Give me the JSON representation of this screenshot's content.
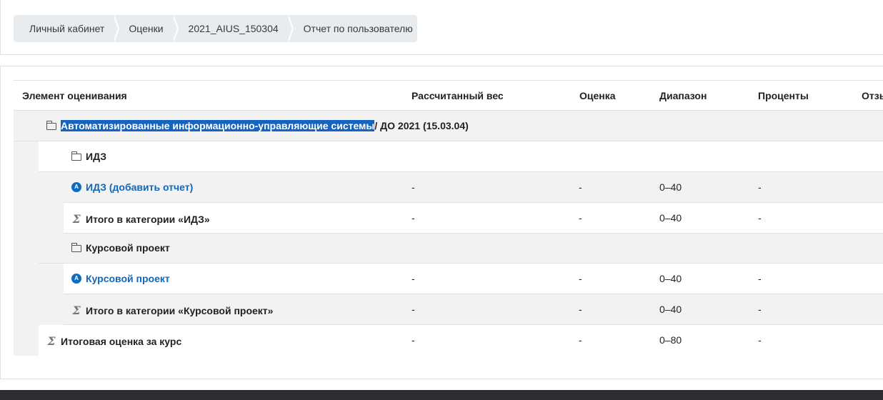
{
  "breadcrumb": {
    "items": [
      "Личный кабинет",
      "Оценки",
      "2021_AIUS_150304",
      "Отчет по пользователю"
    ]
  },
  "table": {
    "headers": {
      "item": "Элемент оценивания",
      "weight": "Рассчитанный вес",
      "grade": "Оценка",
      "range": "Диапазон",
      "percent": "Проценты",
      "feedback": "Отзы"
    },
    "course": {
      "selected": "Автоматизированные информационно-управляющие системы",
      "rest": " / ДО 2021 (15.03.04)"
    },
    "rows": [
      {
        "label": "ИДЗ",
        "icon": "folder-icon"
      },
      {
        "label": "ИДЗ (добавить отчет)",
        "icon": "assignment-icon",
        "weight": "-",
        "grade": "-",
        "range": "0–40",
        "percent": "-"
      },
      {
        "label": "Итого в категории «ИДЗ»",
        "icon": "sigma-icon",
        "weight": "-",
        "grade": "-",
        "range": "0–40",
        "percent": "-"
      },
      {
        "label": "Курсовой проект",
        "icon": "folder-icon"
      },
      {
        "label": "Курсовой проект",
        "icon": "assignment-icon",
        "weight": "-",
        "grade": "-",
        "range": "0–40",
        "percent": "-"
      },
      {
        "label": "Итого в категории «Курсовой проект»",
        "icon": "sigma-icon",
        "weight": "-",
        "grade": "-",
        "range": "0–40",
        "percent": "-"
      },
      {
        "label": "Итоговая оценка за курс",
        "icon": "sigma-icon",
        "weight": "-",
        "grade": "-",
        "range": "0–80",
        "percent": "-"
      }
    ],
    "icons": {
      "sigma": "Σ",
      "assign": "A"
    }
  },
  "colors": {
    "accent": "#0f6cbf",
    "selection": "#1565c0",
    "row_alt": "#f2f2f2"
  }
}
